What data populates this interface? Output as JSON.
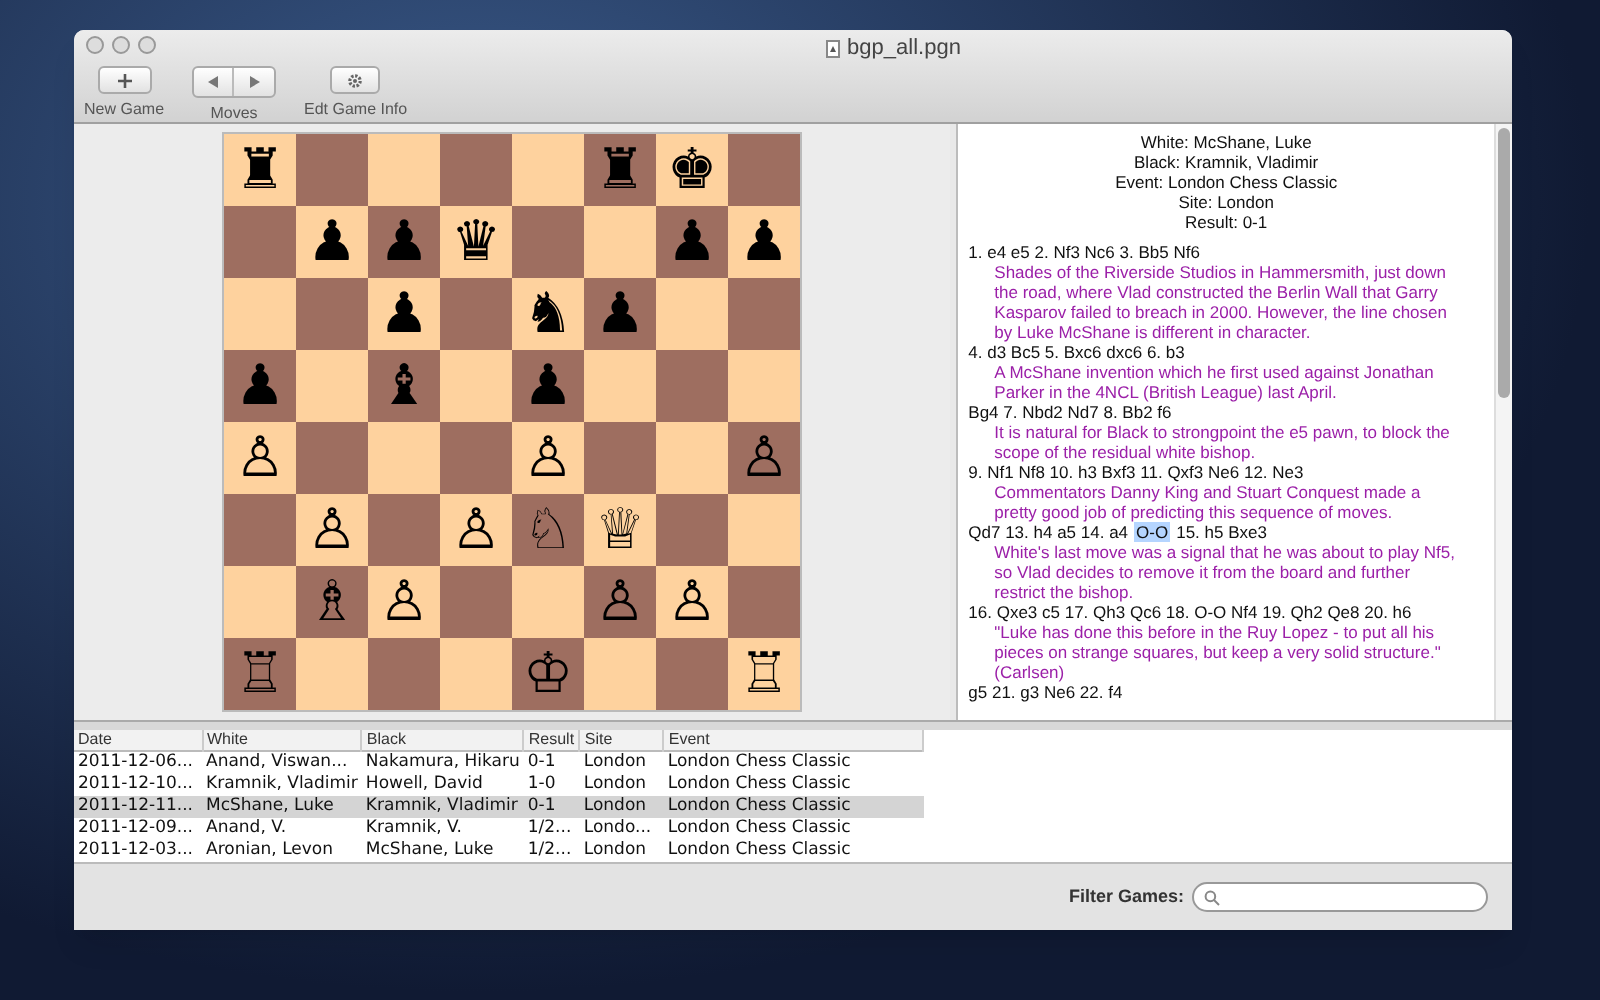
{
  "window": {
    "title": "bgp_all.pgn"
  },
  "toolbar": [
    {
      "label": "New Game",
      "kind": "add"
    },
    {
      "label": "Moves",
      "kind": "moves"
    },
    {
      "label": "Edt Game Info",
      "kind": "gear"
    }
  ],
  "board": {
    "ranks": [
      [
        {
          "kind": "piece",
          "piece": "♜"
        },
        {
          "kind": "empty"
        },
        {
          "kind": "empty"
        },
        {
          "kind": "empty"
        },
        {
          "kind": "empty"
        },
        {
          "kind": "piece",
          "piece": "♜"
        },
        {
          "kind": "piece",
          "piece": "♚"
        },
        {
          "kind": "empty"
        }
      ],
      [
        {
          "kind": "empty"
        },
        {
          "kind": "piece",
          "piece": "♟"
        },
        {
          "kind": "piece",
          "piece": "♟"
        },
        {
          "kind": "piece",
          "piece": "♛"
        },
        {
          "kind": "empty"
        },
        {
          "kind": "empty"
        },
        {
          "kind": "piece",
          "piece": "♟"
        },
        {
          "kind": "piece",
          "piece": "♟"
        }
      ],
      [
        {
          "kind": "empty"
        },
        {
          "kind": "empty"
        },
        {
          "kind": "piece",
          "piece": "♟"
        },
        {
          "kind": "empty"
        },
        {
          "kind": "piece",
          "piece": "♞"
        },
        {
          "kind": "piece",
          "piece": "♟"
        },
        {
          "kind": "empty"
        },
        {
          "kind": "empty"
        }
      ],
      [
        {
          "kind": "piece",
          "piece": "♟"
        },
        {
          "kind": "empty"
        },
        {
          "kind": "piece",
          "piece": "♝"
        },
        {
          "kind": "empty"
        },
        {
          "kind": "piece",
          "piece": "♟"
        },
        {
          "kind": "empty"
        },
        {
          "kind": "empty"
        },
        {
          "kind": "empty"
        }
      ],
      [
        {
          "kind": "piece",
          "piece": "♙"
        },
        {
          "kind": "empty"
        },
        {
          "kind": "empty"
        },
        {
          "kind": "empty"
        },
        {
          "kind": "piece",
          "piece": "♙"
        },
        {
          "kind": "empty"
        },
        {
          "kind": "empty"
        },
        {
          "kind": "piece",
          "piece": "♙"
        }
      ],
      [
        {
          "kind": "empty"
        },
        {
          "kind": "piece",
          "piece": "♙"
        },
        {
          "kind": "empty"
        },
        {
          "kind": "piece",
          "piece": "♙"
        },
        {
          "kind": "piece",
          "piece": "♘"
        },
        {
          "kind": "piece",
          "piece": "♕"
        },
        {
          "kind": "empty"
        },
        {
          "kind": "empty"
        }
      ],
      [
        {
          "kind": "empty"
        },
        {
          "kind": "piece",
          "piece": "♗"
        },
        {
          "kind": "piece",
          "piece": "♙"
        },
        {
          "kind": "empty"
        },
        {
          "kind": "empty"
        },
        {
          "kind": "piece",
          "piece": "♙"
        },
        {
          "kind": "piece",
          "piece": "♙"
        },
        {
          "kind": "empty"
        }
      ],
      [
        {
          "kind": "piece",
          "piece": "♖"
        },
        {
          "kind": "empty"
        },
        {
          "kind": "empty"
        },
        {
          "kind": "empty"
        },
        {
          "kind": "piece",
          "piece": "♔"
        },
        {
          "kind": "empty"
        },
        {
          "kind": "empty"
        },
        {
          "kind": "piece",
          "piece": "♖"
        }
      ]
    ]
  },
  "header": [
    "White: McShane, Luke",
    "Black: Kramnik, Vladimir",
    "Event: London Chess Classic",
    "Site: London",
    "Result: 0-1"
  ],
  "notation": [
    {
      "kind": "moves",
      "parts": [
        {
          "text": "1. e4 e5 2. Nf3 Nc6 3. Bb5 Nf6",
          "selected": false
        }
      ]
    },
    {
      "kind": "comment",
      "text": "Shades of the Riverside Studios in Hammersmith, just down the road, where Vlad constructed the Berlin Wall that Garry Kasparov  failed to breach in 2000. However, the line chosen by Luke McShane is  different in character."
    },
    {
      "kind": "moves",
      "parts": [
        {
          "text": "4. d3 Bc5 5. Bxc6 dxc6 6. b3",
          "selected": false
        }
      ]
    },
    {
      "kind": "comment",
      "text": "A McShane invention  which he first used against Jonathan Parker in the 4NCL (British League) last April."
    },
    {
      "kind": "moves",
      "parts": [
        {
          "text": "Bg4 7. Nbd2 Nd7 8. Bb2 f6",
          "selected": false
        }
      ]
    },
    {
      "kind": "comment",
      "text": "It is natural for Black to strongpoint the  e5 pawn, to block the scope of the residual white bishop."
    },
    {
      "kind": "moves",
      "parts": [
        {
          "text": "9. Nf1 Nf8 10. h3 Bxf3 11. Qxf3 Ne6 12. Ne3",
          "selected": false
        }
      ]
    },
    {
      "kind": "comment",
      "text": "Commentators Danny King and Stuart Conquest made a  pretty good job of predicting this sequence of moves."
    },
    {
      "kind": "moves",
      "parts": [
        {
          "text": "Qd7 13. h4 a5 14. a4",
          "selected": false
        },
        {
          "text": "O-O",
          "selected": true
        },
        {
          "text": "15. h5 Bxe3",
          "selected": false
        }
      ]
    },
    {
      "kind": "comment",
      "text": "White's last move was a signal that he was about to play Nf5, so  Vlad decides to remove it from the board and further restrict the bishop."
    },
    {
      "kind": "moves",
      "parts": [
        {
          "text": "16. Qxe3 c5 17. Qh3 Qc6 18. O-O Nf4 19. Qh2 Qe8 20. h6",
          "selected": false
        }
      ]
    },
    {
      "kind": "comment",
      "text": "\"Luke has done this before  in the Ruy Lopez - to put all his pieces on strange squares, but keep a very solid structure.\" (Carlsen)"
    },
    {
      "kind": "moves",
      "parts": [
        {
          "text": "g5 21. g3 Ne6 22. f4",
          "selected": false
        }
      ]
    }
  ],
  "table": {
    "columns": [
      "Date",
      "White",
      "Black",
      "Result",
      "Site",
      "Event"
    ],
    "rows": [
      {
        "cells": [
          "2011-12-06...",
          "Anand, Viswan...",
          "Nakamura, Hikaru",
          "0-1",
          "London",
          "London Chess Classic"
        ],
        "selected": false
      },
      {
        "cells": [
          "2011-12-10...",
          "Kramnik, Vladimir",
          "Howell, David",
          "1-0",
          "London",
          "London Chess Classic"
        ],
        "selected": false
      },
      {
        "cells": [
          "2011-12-11...",
          "McShane, Luke",
          "Kramnik, Vladimir",
          "0-1",
          "London",
          "London Chess Classic"
        ],
        "selected": true
      },
      {
        "cells": [
          "2011-12-09...",
          "Anand, V.",
          "Kramnik, V.",
          "1/2...",
          "Londo...",
          "London Chess Classic"
        ],
        "selected": false
      },
      {
        "cells": [
          "2011-12-03...",
          "Aronian, Levon",
          "McShane, Luke",
          "1/2...",
          "London",
          "London Chess Classic"
        ],
        "selected": false
      }
    ]
  },
  "filter": {
    "label": "Filter Games:"
  }
}
